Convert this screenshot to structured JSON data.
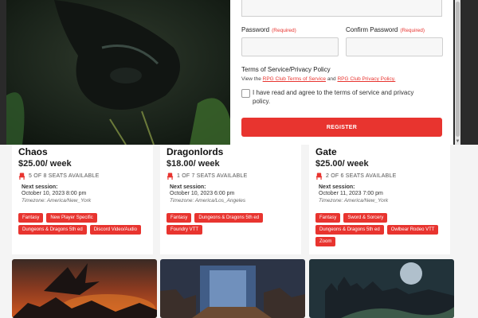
{
  "listings": [
    {
      "title": "Chaos",
      "price": "$25.00/ week",
      "seats": "5 OF 8 SEATS AVAILABLE",
      "next_session_label": "Next session:",
      "next_session_date": "October 10, 2023 8:00 pm",
      "timezone": "Timezone: America/New_York",
      "tags": [
        "Fantasy",
        "New Player Specific",
        "Dungeons & Dragons 5th ed",
        "Discord Video/Audio"
      ]
    },
    {
      "title": "Dragonlords",
      "price": "$18.00/ week",
      "seats": "1 OF 7 SEATS AVAILABLE",
      "next_session_label": "Next session:",
      "next_session_date": "October 10, 2023 6:00 pm",
      "timezone": "Timezone: America/Los_Angeles",
      "tags": [
        "Fantasy",
        "Dungeons & Dragons 5th ed",
        "Foundry VTT"
      ]
    },
    {
      "title": "Gate",
      "price": "$25.00/ week",
      "seats": "2 OF 6 SEATS AVAILABLE",
      "next_session_label": "Next session:",
      "next_session_date": "October 11, 2023 7:00 pm",
      "timezone": "Timezone: America/New_York",
      "tags": [
        "Fantasy",
        "Sword & Sorcery",
        "Dungeons & Dragons 5th ed",
        "Owlbear Rodeo VTT",
        "Zoom"
      ]
    }
  ],
  "form": {
    "password_label": "Password",
    "confirm_password_label": "Confirm Password",
    "required_text": "(Required)",
    "password_value": "",
    "confirm_password_value": "",
    "terms_title": "Terms of Service/Privacy Policy",
    "terms_prefix": "View the",
    "terms_link": "RPG Club Terms of Service",
    "terms_and": "and",
    "privacy_link": "RPG Club Privacy Policy.",
    "agree_label": "I have read and agree to the terms of service and privacy policy.",
    "register_label": "REGISTER"
  },
  "colors": {
    "accent": "#e8342f",
    "overlay": "#2a2a2a"
  },
  "icons": {
    "seat": "seat-icon"
  }
}
